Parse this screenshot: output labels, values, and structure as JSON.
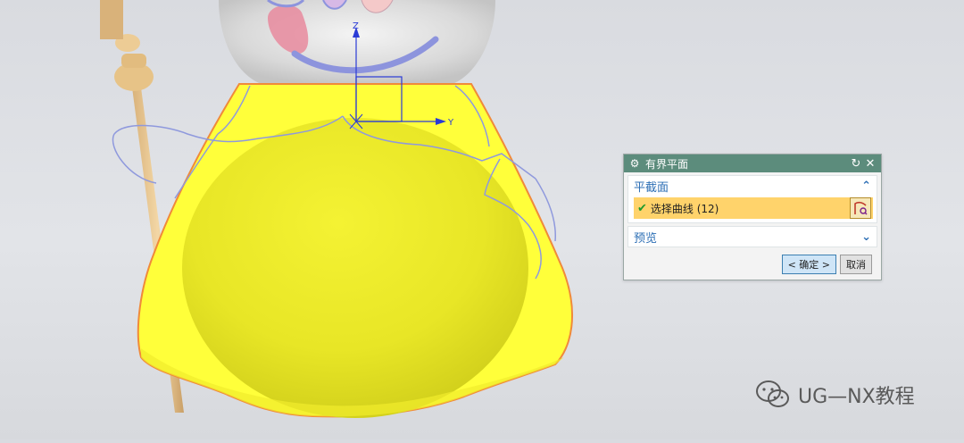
{
  "dialog": {
    "title": "有界平面",
    "title_icon": "gear-icon",
    "section_plane": {
      "label": "平截面",
      "select_curve_label": "选择曲线 (12)"
    },
    "section_preview": {
      "label": "预览"
    },
    "ok_label": "< 确定 >",
    "cancel_label": "取消"
  },
  "axes": {
    "z_label": "Z",
    "y_label": "Y"
  },
  "watermark": {
    "text": "UG—NX教程"
  },
  "colors": {
    "dialog_title_bar": "#5c8c7c",
    "selection_highlight": "#ffd36b",
    "surface_yellow": "#ffff33",
    "edge_orange": "#f08a3a",
    "curve_blue": "#8f99dd",
    "axis_blue": "#2a3bd6"
  }
}
